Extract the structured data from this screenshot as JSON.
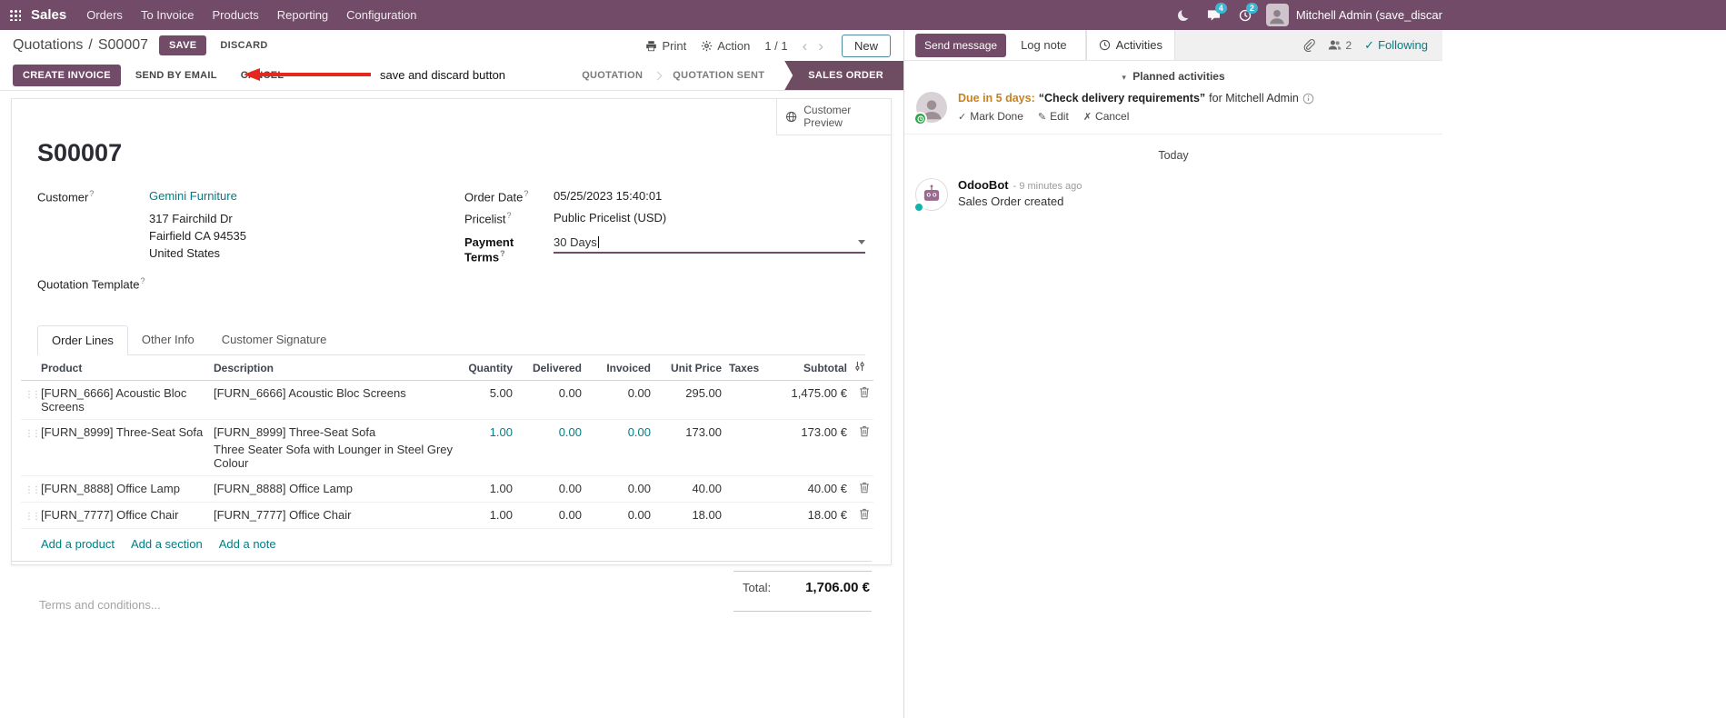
{
  "theme": {
    "brand_color": "#714B67",
    "link_color": "#017e84",
    "annotation_color": "#e5281f",
    "due_warning_color": "#c7821e",
    "badge_color": "#3bb5d3",
    "active_step_color": "#6e4d63"
  },
  "navbar": {
    "brand": "Sales",
    "menus": [
      "Orders",
      "To Invoice",
      "Products",
      "Reporting",
      "Configuration"
    ],
    "message_badge": "4",
    "activity_badge": "2",
    "user_name": "Mitchell Admin (save_discar"
  },
  "control_panel": {
    "breadcrumb_parent": "Quotations",
    "breadcrumb_separator": "/",
    "breadcrumb_current": "S00007",
    "save_label": "SAVE",
    "discard_label": "DISCARD",
    "annotation_text": "save and discard button",
    "print_label": "Print",
    "action_label": "Action",
    "pager": "1 / 1",
    "new_label": "New"
  },
  "statusbar": {
    "create_invoice": "CREATE INVOICE",
    "send_by_email": "SEND BY EMAIL",
    "cancel": "CANCEL",
    "steps": [
      {
        "label": "QUOTATION",
        "active": false
      },
      {
        "label": "QUOTATION SENT",
        "active": false
      },
      {
        "label": "SALES ORDER",
        "active": true
      }
    ]
  },
  "sheet": {
    "customer_preview": "Customer Preview",
    "title": "S00007",
    "help_marker": "?",
    "fields": {
      "customer_label": "Customer",
      "customer_name": "Gemini Furniture",
      "address_line1": "317 Fairchild Dr",
      "address_line2": "Fairfield CA 94535",
      "address_line3": "United States",
      "quotation_template_label": "Quotation Template",
      "order_date_label": "Order Date",
      "order_date_value": "05/25/2023 15:40:01",
      "pricelist_label": "Pricelist",
      "pricelist_value": "Public Pricelist (USD)",
      "payment_terms_label": "Payment Terms",
      "payment_terms_value": "30 Days"
    },
    "tabs": [
      {
        "label": "Order Lines"
      },
      {
        "label": "Other Info"
      },
      {
        "label": "Customer Signature"
      }
    ],
    "table": {
      "headers": {
        "product": "Product",
        "description": "Description",
        "quantity": "Quantity",
        "delivered": "Delivered",
        "invoiced": "Invoiced",
        "unit_price": "Unit Price",
        "taxes": "Taxes",
        "subtotal": "Subtotal"
      },
      "rows": [
        {
          "product": "[FURN_6666] Acoustic Bloc Screens",
          "description": "[FURN_6666] Acoustic Bloc Screens",
          "quantity": "5.00",
          "delivered": "0.00",
          "invoiced": "0.00",
          "unit_price": "295.00",
          "taxes": "",
          "subtotal": "1,475.00 €"
        },
        {
          "product": "[FURN_8999] Three-Seat Sofa",
          "description": "[FURN_8999] Three-Seat Sofa",
          "description_line2": "Three Seater Sofa with Lounger in Steel Grey Colour",
          "quantity": "1.00",
          "delivered": "0.00",
          "invoiced": "0.00",
          "unit_price": "173.00",
          "taxes": "",
          "subtotal": "173.00 €"
        },
        {
          "product": "[FURN_8888] Office Lamp",
          "description": "[FURN_8888] Office Lamp",
          "quantity": "1.00",
          "delivered": "0.00",
          "invoiced": "0.00",
          "unit_price": "40.00",
          "taxes": "",
          "subtotal": "40.00 €"
        },
        {
          "product": "[FURN_7777] Office Chair",
          "description": "[FURN_7777] Office Chair",
          "quantity": "1.00",
          "delivered": "0.00",
          "invoiced": "0.00",
          "unit_price": "18.00",
          "taxes": "",
          "subtotal": "18.00 €"
        }
      ],
      "add_product": "Add a product",
      "add_section": "Add a section",
      "add_note": "Add a note"
    },
    "terms_placeholder": "Terms and conditions...",
    "total_label": "Total:",
    "total_value": "1,706.00 €"
  },
  "chatter": {
    "send_message": "Send message",
    "log_note": "Log note",
    "activities_tab": "Activities",
    "followers_count": "2",
    "following": "Following",
    "planned_activities_header": "Planned activities",
    "activity": {
      "due": "Due in 5 days:",
      "summary": "“Check delivery requirements”",
      "assignee": "for Mitchell Admin",
      "mark_done": "Mark Done",
      "edit": "Edit",
      "cancel": "Cancel"
    },
    "date_divider": "Today",
    "message": {
      "author": "OdooBot",
      "timestamp": "- 9 minutes ago",
      "body": "Sales Order created"
    }
  }
}
